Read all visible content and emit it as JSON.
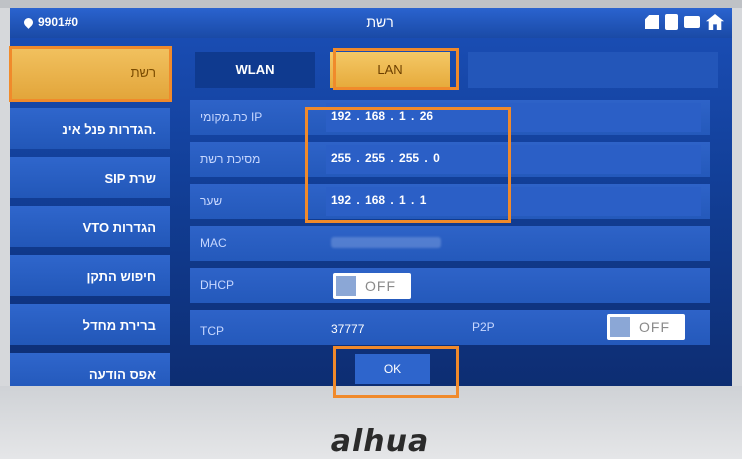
{
  "topbar": {
    "device_id": "9901#0",
    "title": "רשת"
  },
  "sidebar": {
    "items": [
      {
        "label": "רשת",
        "active": true
      },
      {
        "label": ".הגדרות פנל אינ"
      },
      {
        "label": "שרת SIP"
      },
      {
        "label": "הגדרות VTO"
      },
      {
        "label": "חיפוש התקן"
      },
      {
        "label": "ברירת מחדל"
      },
      {
        "label": "אפס הודעה"
      }
    ]
  },
  "tabs": [
    {
      "label": "WLAN"
    },
    {
      "label": "LAN",
      "active": true
    }
  ],
  "form": {
    "ip": {
      "label": "IP כת.מקומי",
      "value": "192 . 168 . 1 . 26"
    },
    "mask": {
      "label": "מסיכת רשת",
      "value": "255 . 255 . 255 . 0"
    },
    "gateway": {
      "label": "שער",
      "value": "192 . 168 . 1 . 1"
    },
    "mac": {
      "label": "MAC"
    },
    "dhcp": {
      "label": "DHCP",
      "state": "OFF"
    },
    "tcp": {
      "label": "TCP",
      "value": "37777"
    },
    "p2p": {
      "label": "P2P",
      "state": "OFF"
    }
  },
  "ok_button": {
    "label": "OK"
  },
  "brand": "alhua",
  "colors": {
    "accent": "#f08a2b",
    "active_tab": "#e6aa3b",
    "panel": "#2459bb"
  }
}
